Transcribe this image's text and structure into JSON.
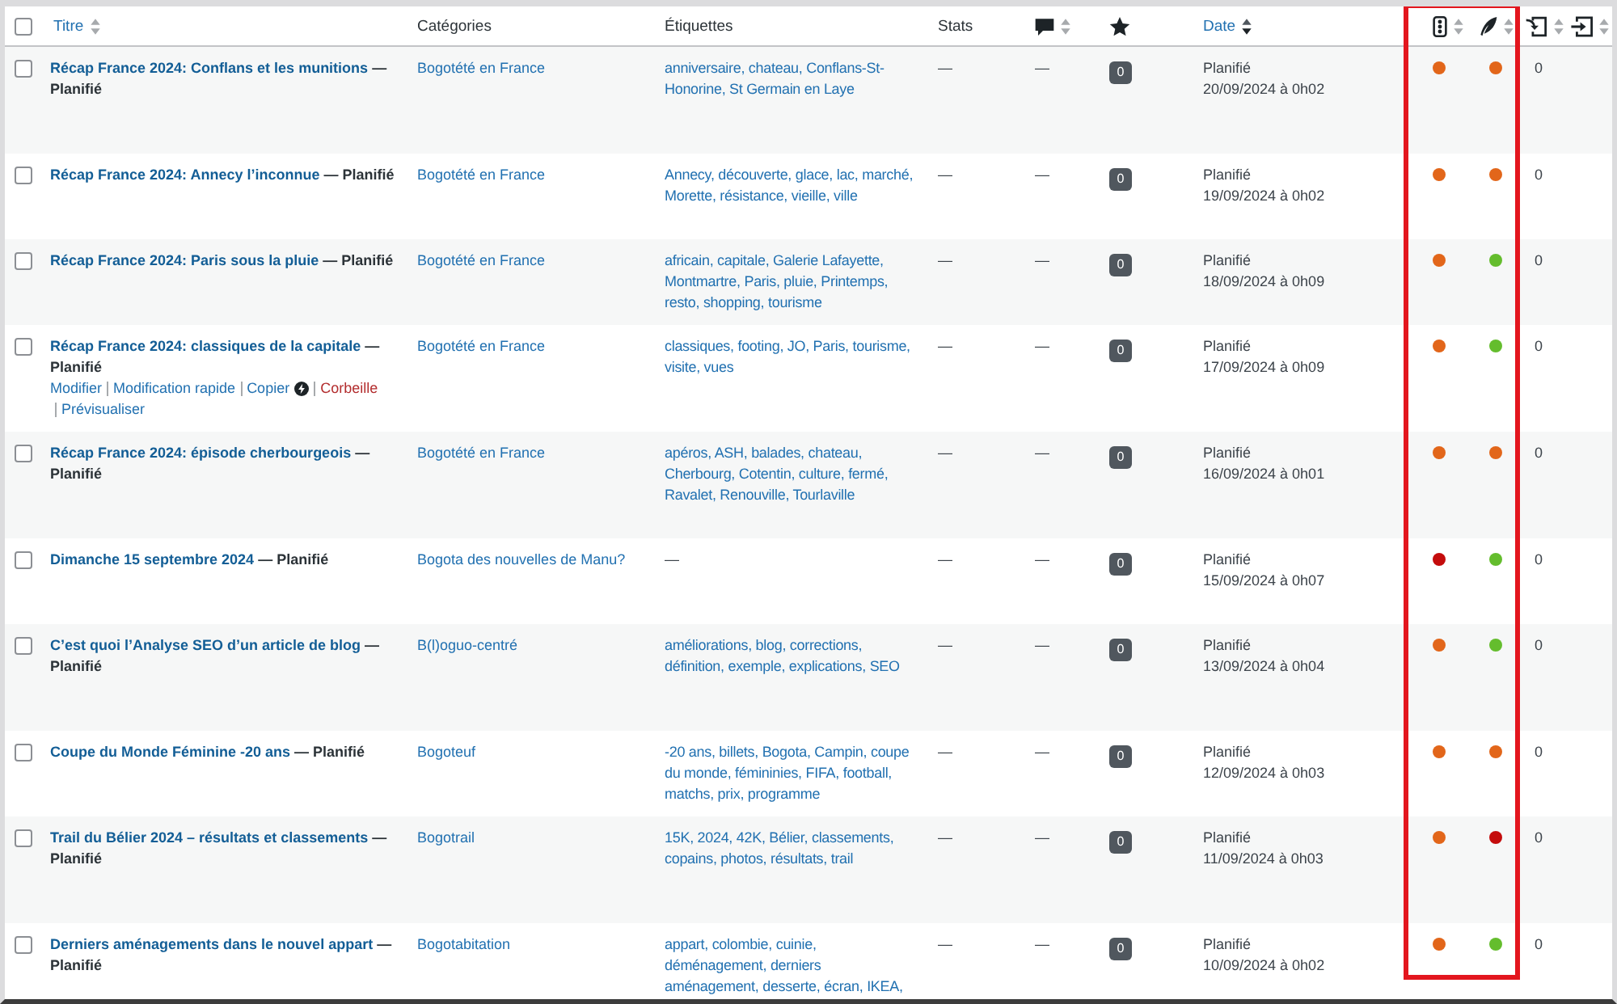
{
  "select_all": {
    "checked": false
  },
  "columns": [
    {
      "kind": "text",
      "label": "Titre",
      "sortable": true,
      "sorted": false,
      "highlighted": false
    },
    {
      "kind": "text",
      "label": "Catégories",
      "sortable": false,
      "highlighted": false
    },
    {
      "kind": "text",
      "label": "Étiquettes",
      "sortable": false,
      "highlighted": false
    },
    {
      "kind": "text",
      "label": "Stats",
      "sortable": false,
      "highlighted": false
    },
    {
      "kind": "comments",
      "sortable": true,
      "sorted": false,
      "highlighted": false
    },
    {
      "kind": "featured",
      "sortable": false,
      "highlighted": false
    },
    {
      "kind": "text",
      "label": "Date",
      "sortable": true,
      "sorted": true,
      "highlighted": false
    },
    {
      "kind": "seo",
      "sortable": true,
      "sorted": false,
      "highlighted": true
    },
    {
      "kind": "readability",
      "sortable": true,
      "sorted": false,
      "highlighted": true
    },
    {
      "kind": "inlinks",
      "sortable": true,
      "sorted": false,
      "highlighted": false
    },
    {
      "kind": "outlinks",
      "sortable": true,
      "sorted": false,
      "highlighted": false
    }
  ],
  "rows": [
    {
      "checked": false,
      "title": "Récap France 2024: Conflans et les munitions",
      "state": "— Planifié",
      "category": "Bogotété en France",
      "tags": {
        "kind": "links",
        "text": "anniversaire, chateau, Conflans-St-Honorine, St Germain en Laye"
      },
      "stats": "—",
      "comments": "—",
      "count": "0",
      "date_status": "Planifié",
      "date": "20/09/2024 à 0h02",
      "seo": {
        "color": "#e2661a"
      },
      "readability": {
        "color": "#e2661a"
      },
      "links": "0"
    },
    {
      "checked": false,
      "title": "Récap France 2024: Annecy l’inconnue",
      "state": "— Planifié",
      "category": "Bogotété en France",
      "tags": {
        "kind": "links",
        "text": "Annecy, découverte, glace, lac, marché, Morette, résistance, vieille, ville"
      },
      "stats": "—",
      "comments": "—",
      "count": "0",
      "date_status": "Planifié",
      "date": "19/09/2024 à 0h02",
      "seo": {
        "color": "#e2661a"
      },
      "readability": {
        "color": "#e2661a"
      },
      "links": "0"
    },
    {
      "checked": false,
      "title": "Récap France 2024: Paris sous la pluie",
      "state": "— Planifié",
      "category": "Bogotété en France",
      "tags": {
        "kind": "links",
        "text": "africain, capitale, Galerie Lafayette, Montmartre, Paris, pluie, Printemps, resto, shopping, tourisme"
      },
      "stats": "—",
      "comments": "—",
      "count": "0",
      "date_status": "Planifié",
      "date": "18/09/2024 à 0h09",
      "seo": {
        "color": "#e2661a"
      },
      "readability": {
        "color": "#64bd2d"
      },
      "links": "0"
    },
    {
      "checked": false,
      "title": "Récap France 2024: classiques de la capitale",
      "state": "— Planifié",
      "actions": [
        {
          "label": "Modifier",
          "kind": "link",
          "icon": false
        },
        {
          "label": "Modification rapide",
          "kind": "link",
          "icon": false
        },
        {
          "label": "Copier",
          "kind": "link",
          "icon": true
        },
        {
          "label": "Corbeille",
          "kind": "danger",
          "icon": false
        },
        {
          "label": "Prévisualiser",
          "kind": "link",
          "icon": false
        }
      ],
      "category": "Bogotété en France",
      "tags": {
        "kind": "links",
        "text": "classiques, footing, JO, Paris, tourisme, visite, vues"
      },
      "stats": "—",
      "comments": "—",
      "count": "0",
      "date_status": "Planifié",
      "date": "17/09/2024 à 0h09",
      "seo": {
        "color": "#e2661a"
      },
      "readability": {
        "color": "#64bd2d"
      },
      "links": "0"
    },
    {
      "checked": false,
      "title": "Récap France 2024: épisode cherbourgeois",
      "state": "— Planifié",
      "category": "Bogotété en France",
      "tags": {
        "kind": "links",
        "text": "apéros, ASH, balades, chateau, Cherbourg, Cotentin, culture, fermé, Ravalet, Renouville, Tourlaville"
      },
      "stats": "—",
      "comments": "—",
      "count": "0",
      "date_status": "Planifié",
      "date": "16/09/2024 à 0h01",
      "seo": {
        "color": "#e2661a"
      },
      "readability": {
        "color": "#e2661a"
      },
      "links": "0"
    },
    {
      "checked": false,
      "title": "Dimanche 15 septembre 2024",
      "state": "— Planifié",
      "category": "Bogota des nouvelles de Manu?",
      "tags": {
        "kind": "none",
        "text": "—"
      },
      "stats": "—",
      "comments": "—",
      "count": "0",
      "date_status": "Planifié",
      "date": "15/09/2024 à 0h07",
      "seo": {
        "color": "#c40c0c"
      },
      "readability": {
        "color": "#64bd2d"
      },
      "links": "0"
    },
    {
      "checked": false,
      "title": "C’est quoi l’Analyse SEO d’un article de blog",
      "state": "— Planifié",
      "category": "B(l)oguo-centré",
      "tags": {
        "kind": "links",
        "text": "améliorations, blog, corrections, définition, exemple, explications, SEO"
      },
      "stats": "—",
      "comments": "—",
      "count": "0",
      "date_status": "Planifié",
      "date": "13/09/2024 à 0h04",
      "seo": {
        "color": "#e2661a"
      },
      "readability": {
        "color": "#64bd2d"
      },
      "links": "0"
    },
    {
      "checked": false,
      "title": "Coupe du Monde Féminine -20 ans",
      "state": "— Planifié",
      "category": "Bogoteuf",
      "tags": {
        "kind": "links",
        "text": "-20 ans, billets, Bogota, Campin, coupe du monde, fémininies, FIFA, football, matchs, prix, programme"
      },
      "stats": "—",
      "comments": "—",
      "count": "0",
      "date_status": "Planifié",
      "date": "12/09/2024 à 0h03",
      "seo": {
        "color": "#e2661a"
      },
      "readability": {
        "color": "#e2661a"
      },
      "links": "0"
    },
    {
      "checked": false,
      "title": "Trail du Bélier 2024 – résultats et classements",
      "state": "— Planifié",
      "category": "Bogotrail",
      "tags": {
        "kind": "links",
        "text": "15K, 2024, 42K, Bélier, classements, copains, photos, résultats, trail"
      },
      "stats": "—",
      "comments": "—",
      "count": "0",
      "date_status": "Planifié",
      "date": "11/09/2024 à 0h03",
      "seo": {
        "color": "#e2661a"
      },
      "readability": {
        "color": "#c40c0c"
      },
      "links": "0"
    },
    {
      "checked": false,
      "title": "Derniers aménagements dans le nouvel appart",
      "state": "— Planifié",
      "category": "Bogotabitation",
      "tags": {
        "kind": "links",
        "text": "appart, colombie, cuinie, déménagement, derniers aménagement, desserte, écran, IKEA,"
      },
      "stats": "—",
      "comments": "—",
      "count": "0",
      "date_status": "Planifié",
      "date": "10/09/2024 à 0h02",
      "seo": {
        "color": "#e2661a"
      },
      "readability": {
        "color": "#64bd2d"
      },
      "links": "0"
    }
  ]
}
